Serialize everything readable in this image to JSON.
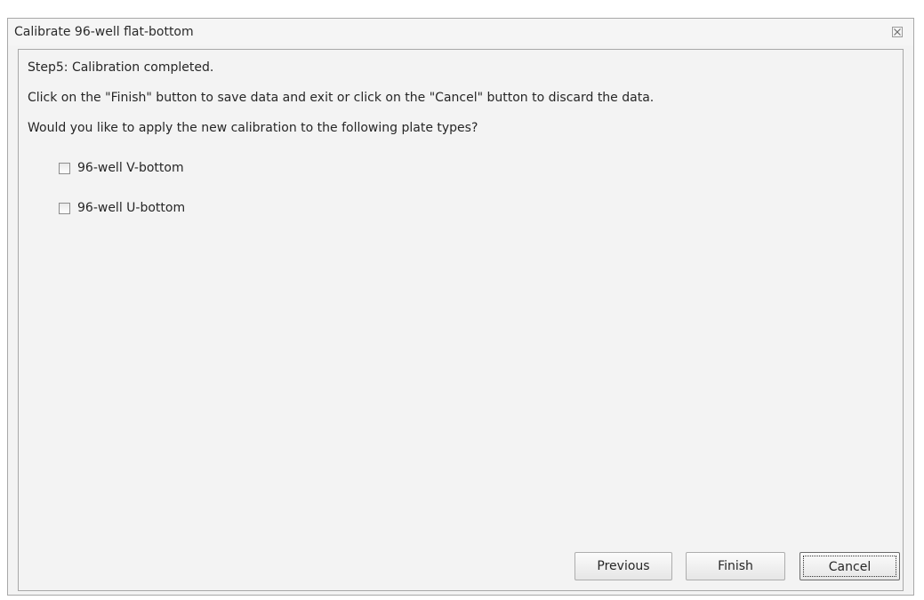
{
  "window": {
    "title": "Calibrate 96-well flat-bottom",
    "close_icon": "close-icon"
  },
  "content": {
    "step_text": "Step5: Calibration completed.",
    "instruction_text": "Click on the \"Finish\" button to save data and exit or click on the \"Cancel\" button to discard the data.",
    "question_text": "Would you like to apply the new calibration to the following plate types?",
    "plate_types": [
      {
        "label": "96-well V-bottom",
        "checked": false
      },
      {
        "label": "96-well U-bottom",
        "checked": false
      }
    ]
  },
  "buttons": {
    "previous_label": "Previous",
    "finish_label": "Finish",
    "cancel_label": "Cancel"
  }
}
